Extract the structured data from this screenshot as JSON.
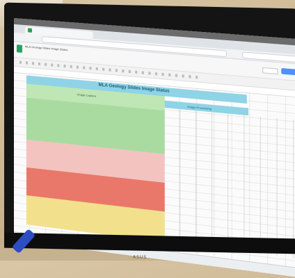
{
  "sheet": {
    "doc_title": "MLA Geology Slides Image Status",
    "title": "MLA Geology Slides Image Status",
    "section_capture": "Image Capture",
    "section_processing": "Image Processing"
  },
  "monitor": {
    "brand": "ASUS"
  },
  "colors": {
    "header_band": "#8fd3e6",
    "green": "#a9dba0",
    "pink": "#f3c3c0",
    "red": "#e9786a",
    "yellow": "#f2e08d",
    "share_button": "#4d90fe"
  }
}
